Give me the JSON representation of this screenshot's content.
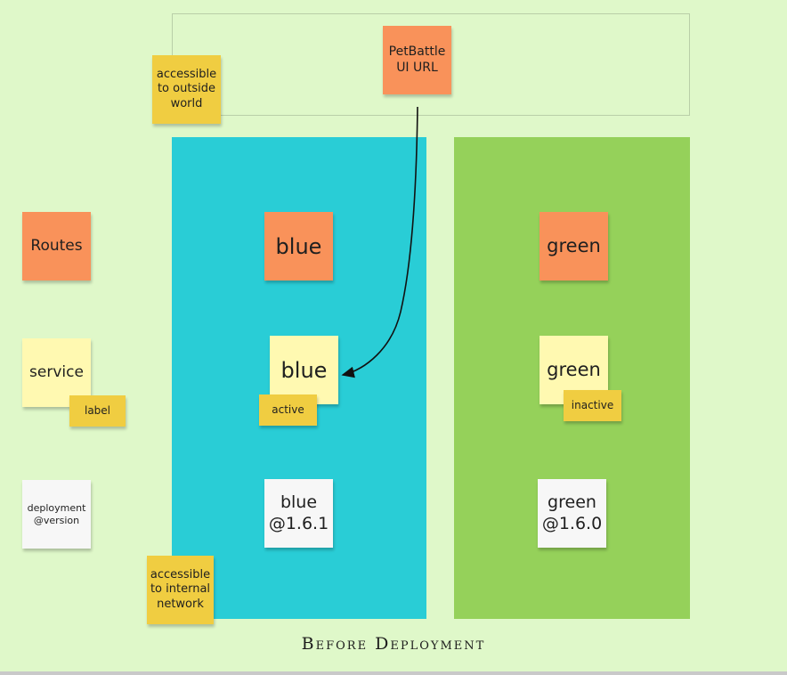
{
  "diagram": {
    "title": "Before Deployment",
    "top_note": {
      "label": "PetBattle\nUI URL"
    },
    "outside_note": {
      "label": "accessible\nto outside\nworld"
    },
    "internal_note": {
      "label": "accessible\nto internal\nnetwork"
    },
    "legend": {
      "routes": "Routes",
      "service": "service",
      "label": "label",
      "deployment": "deployment\n@version"
    },
    "blue_column": {
      "route": "blue",
      "service": "blue",
      "status": "active",
      "deployment": "blue\n@1.6.1"
    },
    "green_column": {
      "route": "green",
      "service": "green",
      "status": "inactive",
      "deployment": "green\n@1.6.0"
    },
    "colors": {
      "background": "#dff8c9",
      "blue_column": "#29cdd6",
      "green_column": "#95d15a",
      "orange_note": "#f9925a",
      "pale_yellow_note": "#fff9b1",
      "yellow_note": "#f0cd41",
      "white_note": "#f7f7f7"
    }
  }
}
